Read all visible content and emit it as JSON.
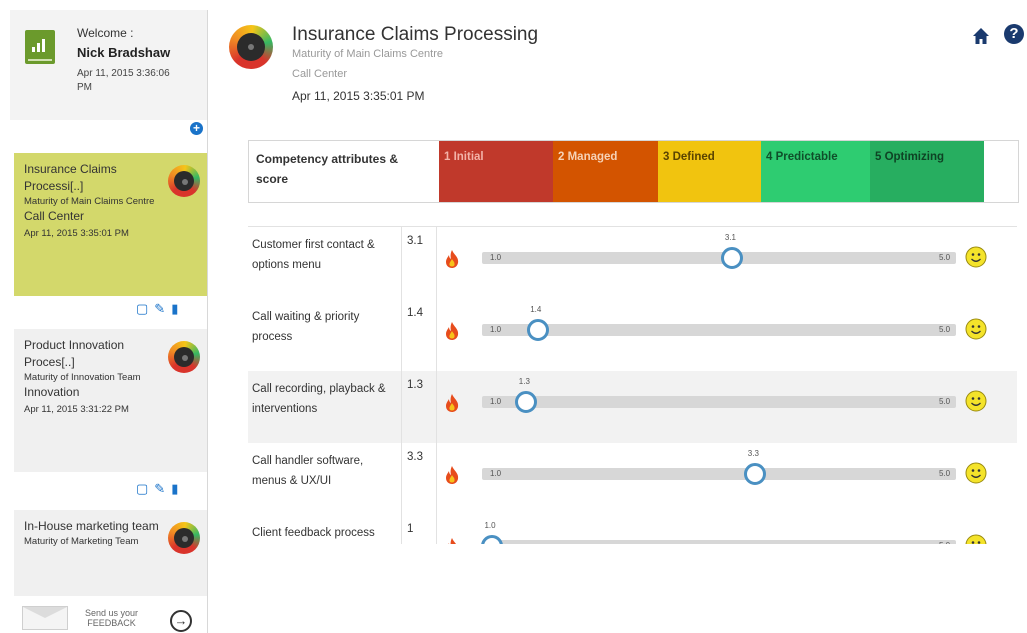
{
  "sidebar": {
    "welcome_label": "Welcome :",
    "user_name": "Nick Bradshaw",
    "login_time": "Apr 11, 2015 3:36:06 PM",
    "cards": [
      {
        "title": "Insurance Claims Processi[..]",
        "subtitle": "Maturity of Main Claims Centre",
        "category": "Call Center",
        "date": "Apr 11, 2015 3:35:01 PM",
        "active": true
      },
      {
        "title": "Product Innovation Proces[..]",
        "subtitle": "Maturity of Innovation Team",
        "category": "Innovation",
        "date": "Apr 11, 2015 3:31:22 PM",
        "active": false
      },
      {
        "title": "In-House marketing team",
        "subtitle": "Maturity of Marketing Team",
        "category": "",
        "date": "",
        "active": false
      }
    ],
    "feedback_line1": "Send us your",
    "feedback_line2": "FEEDBACK"
  },
  "header": {
    "title": "Insurance Claims Processing",
    "subtitle": "Maturity of Main Claims Centre",
    "category": "Call Center",
    "date": "Apr 11, 2015 3:35:01 PM"
  },
  "scale": {
    "label": "Competency attributes & score",
    "levels": [
      {
        "label": "1 Initial",
        "color": "#c0392b",
        "text_color": "#f3b3a8"
      },
      {
        "label": "2 Managed",
        "color": "#d35400",
        "text_color": "#f6d2b6"
      },
      {
        "label": "3 Defined",
        "color": "#f1c40f",
        "text_color": "#5a4300"
      },
      {
        "label": "4 Predictable",
        "color": "#2ecc71",
        "text_color": "#0f4f2a"
      },
      {
        "label": "5 Optimizing",
        "color": "#27ae60",
        "text_color": "#0e4324"
      }
    ]
  },
  "slider": {
    "min_label": "1.0",
    "max_label": "5.0",
    "min": 1,
    "max": 5
  },
  "rows": [
    {
      "name": "Customer first contact & options menu",
      "score": "3.1",
      "value": 3.1,
      "value_label": "3.1"
    },
    {
      "name": "Call waiting & priority process",
      "score": "1.4",
      "value": 1.4,
      "value_label": "1.4"
    },
    {
      "name": "Call recording, playback & interventions",
      "score": "1.3",
      "value": 1.3,
      "value_label": "1.3"
    },
    {
      "name": "Call handler software, menus & UX/UI",
      "score": "3.3",
      "value": 3.3,
      "value_label": "3.3"
    },
    {
      "name": "Client feedback process",
      "score": "1",
      "value": 1.0,
      "value_label": "1.0"
    }
  ],
  "colors": {
    "accent": "#1a73c9",
    "active_card": "#d3d86b",
    "slider_handle": "#4a90c2"
  }
}
